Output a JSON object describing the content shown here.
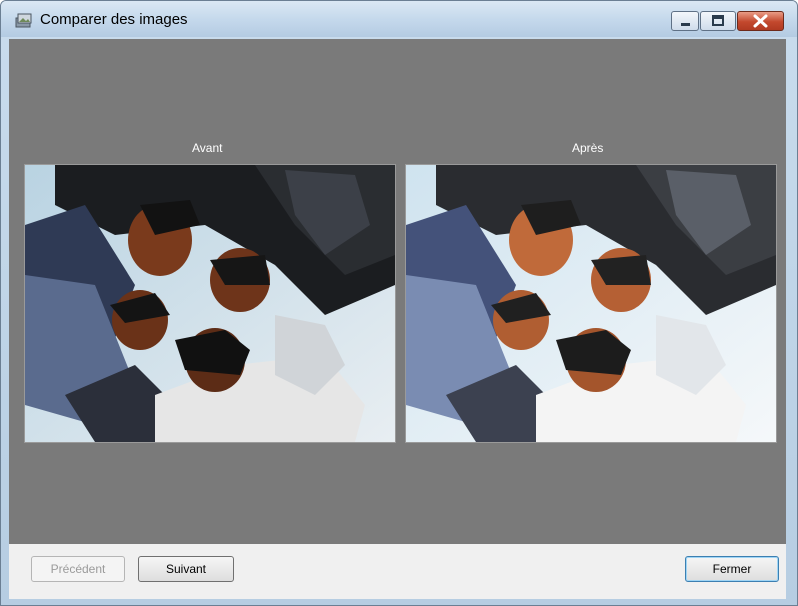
{
  "window": {
    "title": "Comparer des images",
    "icons": {
      "app": "app-image-icon",
      "minimize": "minimize-icon",
      "maximize": "maximize-icon",
      "close": "close-icon"
    }
  },
  "compare": {
    "before_label": "Avant",
    "after_label": "Après",
    "before_image": "group-photo-before",
    "after_image": "group-photo-after"
  },
  "buttons": {
    "previous": "Précédent",
    "next": "Suivant",
    "close": "Fermer"
  },
  "colors": {
    "client_bg": "#7a7a7a",
    "footer_bg": "#f0f0f0",
    "close_button": "#c3482d"
  }
}
